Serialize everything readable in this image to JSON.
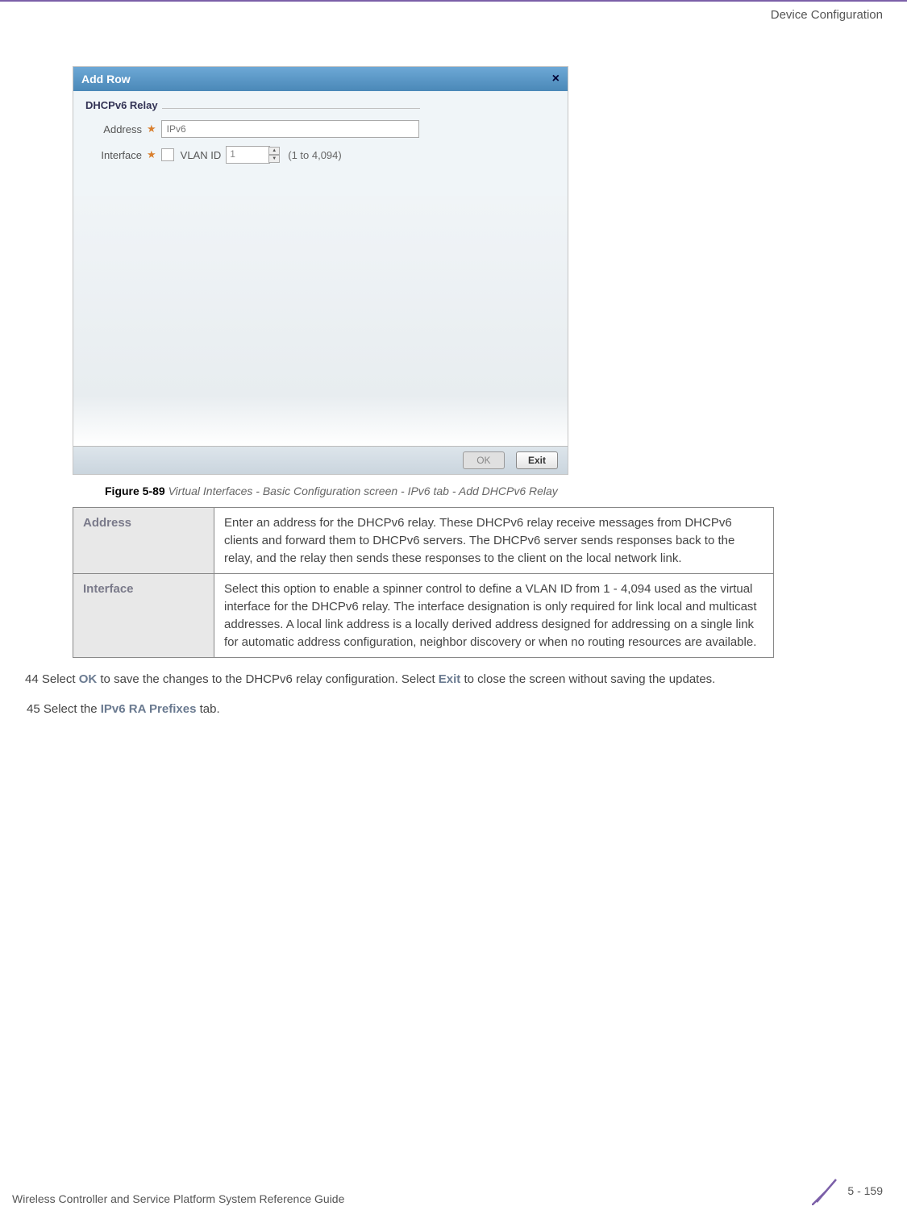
{
  "header": {
    "section": "Device Configuration"
  },
  "modal": {
    "title": "Add Row",
    "close_glyph": "×",
    "fieldset_label": "DHCPv6 Relay",
    "address_label": "Address",
    "address_placeholder": "IPv6",
    "interface_label": "Interface",
    "vlan_label": "VLAN ID",
    "vlan_value": "1",
    "vlan_range": "(1 to 4,094)",
    "ok_label": "OK",
    "exit_label": "Exit"
  },
  "figure": {
    "label": "Figure 5-89",
    "desc": "Virtual Interfaces - Basic Configuration screen - IPv6 tab - Add DHCPv6 Relay"
  },
  "params": {
    "address": {
      "name": "Address",
      "desc": "Enter an address for the DHCPv6 relay. These DHCPv6 relay receive messages from DHCPv6 clients and forward them to DHCPv6 servers. The DHCPv6 server sends responses back to the relay, and the relay then sends these responses to the client on the local network link."
    },
    "interface": {
      "name": "Interface",
      "desc": "Select this option to enable a spinner control to define a VLAN ID from 1 - 4,094 used as the virtual interface for the DHCPv6 relay. The interface designation is only required for link local and multicast addresses. A local link address is a locally derived address designed for addressing on a single link for automatic address configuration, neighbor discovery or when no routing resources are available."
    }
  },
  "steps": {
    "s44_pre": "44 Select ",
    "s44_ok": "OK",
    "s44_mid": " to save the changes to the DHCPv6 relay configuration. Select ",
    "s44_exit": "Exit",
    "s44_post": " to close the screen without saving the updates.",
    "s45_pre": "45 Select the ",
    "s45_bold": "IPv6 RA Prefixes",
    "s45_post": " tab."
  },
  "footer": {
    "left": "Wireless Controller and Service Platform System Reference Guide",
    "page": "5 - 159"
  }
}
